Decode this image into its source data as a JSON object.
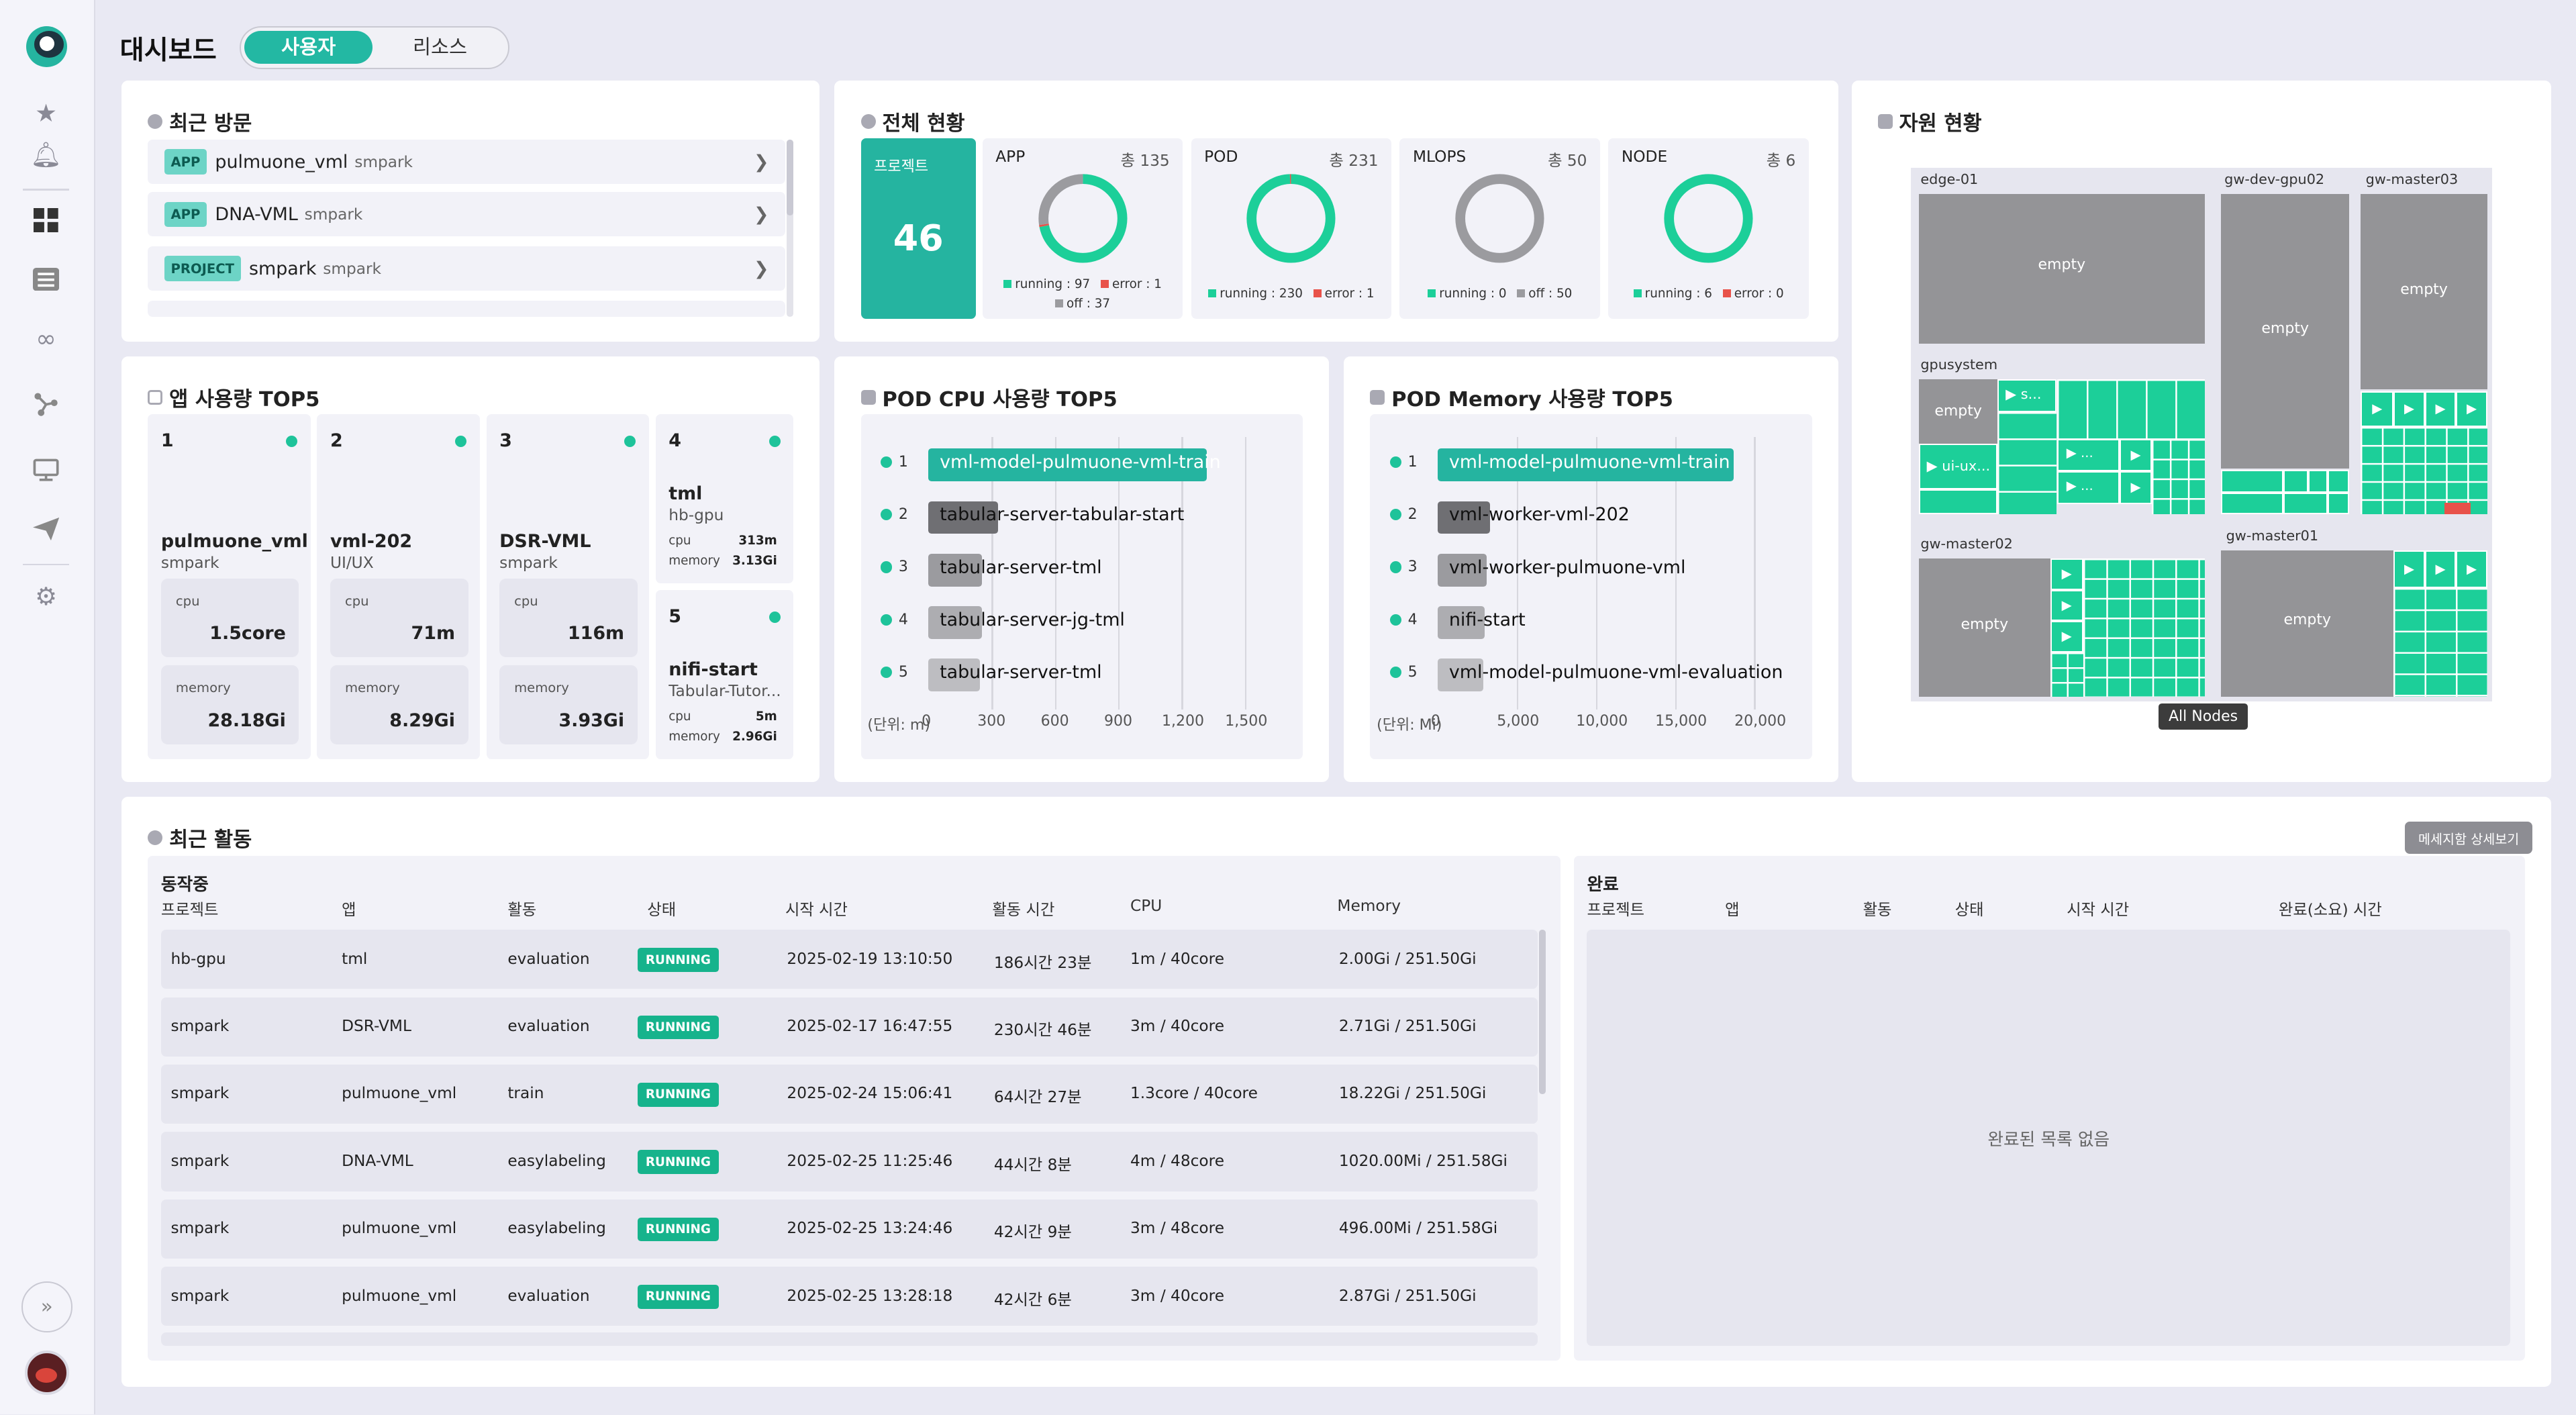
{
  "header": {
    "title": "대시보드",
    "toggle": [
      "사용자",
      "리소스"
    ]
  },
  "sidebar": {
    "icons": [
      "logo-icon",
      "star-icon",
      "bell-icon",
      "dashboard-icon",
      "list-icon",
      "infinity-icon",
      "network-icon",
      "monitor-icon",
      "send-icon",
      "gear-icon",
      "expand-icon",
      "avatar"
    ]
  },
  "recent_visits": {
    "title": "최근 방문",
    "items": [
      {
        "tag": "APP",
        "name": "pulmuone_vml",
        "owner": "smpark"
      },
      {
        "tag": "APP",
        "name": "DNA-VML",
        "owner": "smpark"
      },
      {
        "tag": "PROJECT",
        "name": "smpark",
        "owner": "smpark"
      }
    ]
  },
  "overview": {
    "title": "전체 현황",
    "project": {
      "label": "프로젝트",
      "count": "46"
    },
    "stats": [
      {
        "name": "APP",
        "total": "총 135",
        "legend": [
          [
            "running : 97",
            "error : 1"
          ],
          [
            "off : 37"
          ]
        ]
      },
      {
        "name": "POD",
        "total": "총 231",
        "legend": [
          [
            "running : 230",
            "error : 1"
          ]
        ]
      },
      {
        "name": "MLOPS",
        "total": "총 50",
        "legend": [
          [
            "running : 0",
            "off : 50"
          ]
        ]
      },
      {
        "name": "NODE",
        "total": "총 6",
        "legend": [
          [
            "running : 6",
            "error : 0"
          ]
        ]
      }
    ],
    "donuts": [
      {
        "running": 97,
        "error": 1,
        "off": 37
      },
      {
        "running": 230,
        "error": 1,
        "off": 0
      },
      {
        "running": 0,
        "error": 0,
        "off": 50
      },
      {
        "running": 6,
        "error": 0,
        "off": 0
      }
    ]
  },
  "resources": {
    "title": "자원 현황",
    "nodes": [
      "edge-01",
      "gw-dev-gpu02",
      "gw-master03",
      "gpusystem",
      "gw-master02",
      "gw-master01"
    ],
    "empty": "empty",
    "labels": [
      "s...",
      "ui-ux...",
      "...",
      "..."
    ],
    "tooltip": "All Nodes"
  },
  "app_top5": {
    "title": "앱 사용량 TOP5",
    "items": [
      {
        "rank": "1",
        "app": "pulmuone_vml",
        "project": "smpark",
        "cpu_label": "cpu",
        "cpu": "1.5core",
        "mem_label": "memory",
        "memory": "28.18Gi"
      },
      {
        "rank": "2",
        "app": "vml-202",
        "project": "UI/UX",
        "cpu_label": "cpu",
        "cpu": "71m",
        "mem_label": "memory",
        "memory": "8.29Gi"
      },
      {
        "rank": "3",
        "app": "DSR-VML",
        "project": "smpark",
        "cpu_label": "cpu",
        "cpu": "116m",
        "mem_label": "memory",
        "memory": "3.93Gi"
      },
      {
        "rank": "4",
        "app": "tml",
        "project": "hb-gpu",
        "cpu_label": "cpu",
        "cpu": "313m",
        "mem_label": "memory",
        "memory": "3.13Gi"
      },
      {
        "rank": "5",
        "app": "nifi-start",
        "project": "Tabular-Tutor...",
        "cpu_label": "cpu",
        "cpu": "5m",
        "mem_label": "memory",
        "memory": "2.96Gi"
      }
    ]
  },
  "cpu_top5": {
    "title": "POD CPU 사용량 TOP5",
    "unit": "(단위: m)",
    "ticks": [
      "0",
      "300",
      "600",
      "900",
      "1,200",
      "1,500"
    ]
  },
  "mem_top5": {
    "title": "POD Memory 사용량 TOP5",
    "unit": "(단위: Mi)",
    "ticks": [
      "0",
      "5,000",
      "10,000",
      "15,000",
      "20,000"
    ]
  },
  "chart_data": [
    {
      "type": "bar",
      "title": "POD CPU 사용량 TOP5",
      "categories": [
        "vml-model-pulmuone-vml-train",
        "tabular-server-tabular-start",
        "tabular-server-tml",
        "tabular-server-jg-tml",
        "tabular-server-tml"
      ],
      "ranks": [
        "1",
        "2",
        "3",
        "4",
        "5"
      ],
      "values": [
        1320,
        330,
        255,
        255,
        245
      ],
      "xlim": [
        0,
        1650
      ],
      "xlabel": "(단위: m)",
      "colors": [
        "#25b4a0",
        "#6f6f73",
        "#9b9b9f",
        "#adadb1",
        "#bdbdc1"
      ]
    },
    {
      "type": "bar",
      "title": "POD Memory 사용량 TOP5",
      "categories": [
        "vml-model-pulmuone-vml-train",
        "vml-worker-vml-202",
        "vml-worker-pulmuone-vml",
        "nifi-start",
        "vml-model-pulmuone-vml-evaluation"
      ],
      "ranks": [
        "1",
        "2",
        "3",
        "4",
        "5"
      ],
      "values": [
        18700,
        3300,
        3100,
        3000,
        2900
      ],
      "xlim": [
        0,
        22000
      ],
      "xlabel": "(단위: Mi)",
      "colors": [
        "#25b4a0",
        "#6f6f73",
        "#9b9b9f",
        "#adadb1",
        "#bdbdc1"
      ]
    }
  ],
  "activity": {
    "title": "최근 활동",
    "detail_button": "메세지함 상세보기",
    "running": {
      "title": "동작중",
      "headers": [
        "프로젝트",
        "앱",
        "활동",
        "상태",
        "시작 시간",
        "활동 시간",
        "CPU",
        "Memory"
      ],
      "rows": [
        [
          "hb-gpu",
          "tml",
          "evaluation",
          "RUNNING",
          "2025-02-19 13:10:50",
          "186시간 23분",
          "1m / 40core",
          "2.00Gi / 251.50Gi"
        ],
        [
          "smpark",
          "DSR-VML",
          "evaluation",
          "RUNNING",
          "2025-02-17 16:47:55",
          "230시간 46분",
          "3m / 40core",
          "2.71Gi / 251.50Gi"
        ],
        [
          "smpark",
          "pulmuone_vml",
          "train",
          "RUNNING",
          "2025-02-24 15:06:41",
          "64시간 27분",
          "1.3core / 40core",
          "18.22Gi / 251.50Gi"
        ],
        [
          "smpark",
          "DNA-VML",
          "easylabeling",
          "RUNNING",
          "2025-02-25 11:25:46",
          "44시간 8분",
          "4m / 48core",
          "1020.00Mi / 251.58Gi"
        ],
        [
          "smpark",
          "pulmuone_vml",
          "easylabeling",
          "RUNNING",
          "2025-02-25 13:24:46",
          "42시간 9분",
          "3m / 48core",
          "496.00Mi / 251.58Gi"
        ],
        [
          "smpark",
          "pulmuone_vml",
          "evaluation",
          "RUNNING",
          "2025-02-25 13:28:18",
          "42시간 6분",
          "3m / 40core",
          "2.87Gi / 251.50Gi"
        ]
      ]
    },
    "done": {
      "title": "완료",
      "headers": [
        "프로젝트",
        "앱",
        "활동",
        "상태",
        "시작 시간",
        "완료(소요) 시간"
      ],
      "empty": "완료된 목록 없음"
    }
  },
  "colors": {
    "accent": "#25b4a0",
    "running": "#1ccf99",
    "error": "#e8524a",
    "off": "#9b9b9f"
  }
}
